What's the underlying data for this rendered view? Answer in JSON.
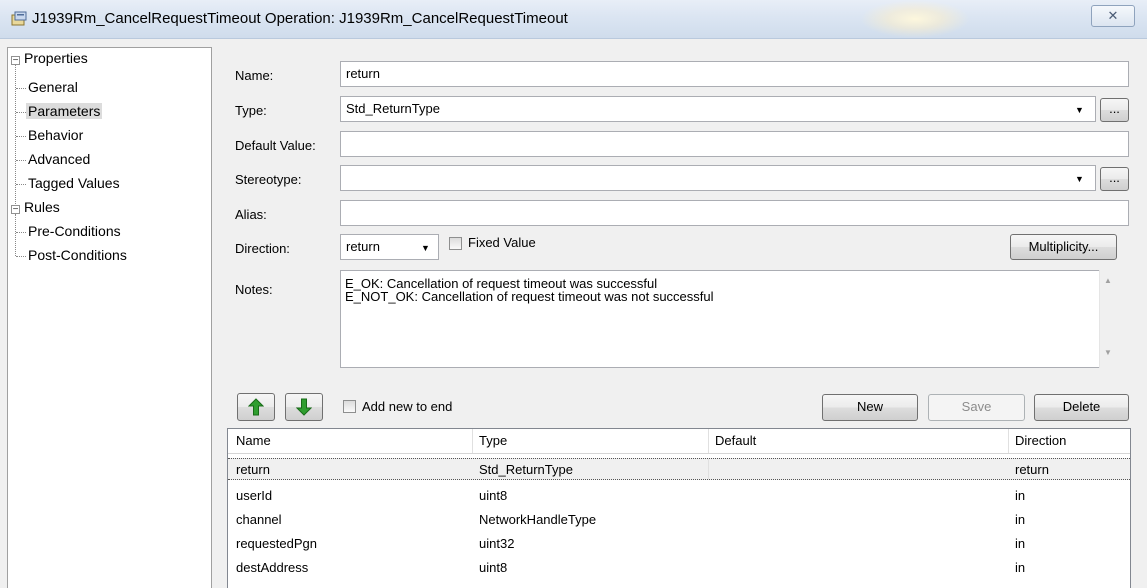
{
  "window": {
    "title": "J1939Rm_CancelRequestTimeout Operation: J1939Rm_CancelRequestTimeout",
    "close_label": "✕"
  },
  "tree": {
    "properties": "Properties",
    "properties_children": [
      "General",
      "Parameters",
      "Behavior",
      "Advanced",
      "Tagged Values"
    ],
    "rules": "Rules",
    "rules_children": [
      "Pre-Conditions",
      "Post-Conditions"
    ],
    "selected": "Parameters",
    "expander": "−"
  },
  "form": {
    "name_label": "Name:",
    "name_value": "return",
    "type_label": "Type:",
    "type_value": "Std_ReturnType",
    "default_label": "Default Value:",
    "default_value": "",
    "stereotype_label": "Stereotype:",
    "stereotype_value": "",
    "alias_label": "Alias:",
    "alias_value": "",
    "direction_label": "Direction:",
    "direction_value": "return",
    "fixed_value_label": "Fixed Value",
    "multiplicity_label": "Multiplicity...",
    "browse_label": "...",
    "notes_label": "Notes:",
    "notes_lines": [
      "E_OK: Cancellation of request timeout was successful",
      "E_NOT_OK: Cancellation of request timeout was not successful"
    ]
  },
  "toolbar": {
    "add_new_to_end": "Add new to end",
    "new": "New",
    "save": "Save",
    "delete": "Delete"
  },
  "table": {
    "columns": [
      "Name",
      "Type",
      "Default",
      "Direction"
    ],
    "rows": [
      [
        "return",
        "Std_ReturnType",
        "",
        "return"
      ],
      [
        "userId",
        "uint8",
        "",
        "in"
      ],
      [
        "channel",
        "NetworkHandleType",
        "",
        "in"
      ],
      [
        "requestedPgn",
        "uint32",
        "",
        "in"
      ],
      [
        "destAddress",
        "uint8",
        "",
        "in"
      ]
    ]
  },
  "colors": {
    "arrow_green": "#2f9e2f",
    "selection": "#dcdcdc"
  }
}
